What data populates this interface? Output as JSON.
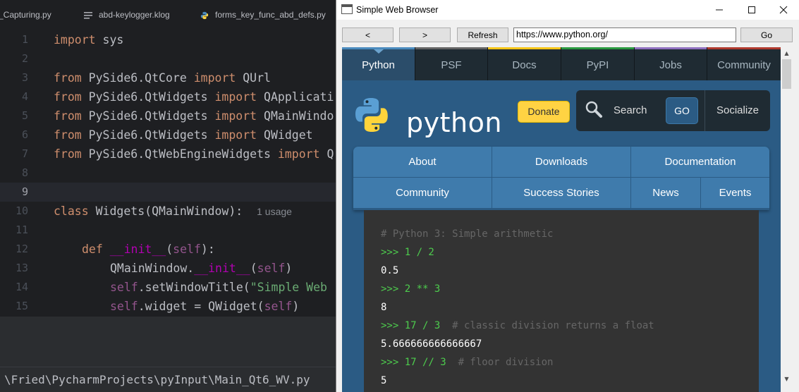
{
  "ide": {
    "tabs": [
      {
        "label": "_Capturing.py"
      },
      {
        "label": "abd-keylogger.klog"
      },
      {
        "label": "forms_key_func_abd_defs.py"
      }
    ],
    "line_numbers": [
      "1",
      "2",
      "3",
      "4",
      "5",
      "6",
      "7",
      "8",
      "9",
      "10",
      "11",
      "12",
      "13",
      "14",
      "15"
    ],
    "code": {
      "l1": {
        "kw": "import",
        "rest": " sys"
      },
      "l3": {
        "kw1": "from",
        "mod": " PySide6.QtCore ",
        "kw2": "import",
        "rest": " QUrl"
      },
      "l4": {
        "kw1": "from",
        "mod": " PySide6.QtWidgets ",
        "kw2": "import",
        "rest": " QApplicati"
      },
      "l5": {
        "kw1": "from",
        "mod": " PySide6.QtWidgets ",
        "kw2": "import",
        "rest": " QMainWindo"
      },
      "l6": {
        "kw1": "from",
        "mod": " PySide6.QtWidgets ",
        "kw2": "import",
        "rest": " QWidget"
      },
      "l7": {
        "kw1": "from",
        "mod": " PySide6.QtWebEngineWidgets ",
        "kw2": "import",
        "rest": " Q"
      },
      "l10": {
        "kw": "class",
        "name": " Widgets",
        "rest": "(QMainWindow):",
        "hint": "1 usage"
      },
      "l12": {
        "kw": "def",
        "name": "__init__",
        "open": "(",
        "self": "self",
        "close": "):"
      },
      "l13": {
        "pre": "QMainWindow.",
        "dunder": "__init__",
        "open": "(",
        "self": "self",
        "close": ")"
      },
      "l14": {
        "self": "self",
        "call": ".setWindowTitle(",
        "str": "\"Simple Web"
      },
      "l15": {
        "self": "self",
        "mid": ".widget = QWidget(",
        "self2": "self",
        "close": ")"
      }
    },
    "status_path": "\\Fried\\PycharmProjects\\pyInput\\Main_Qt6_WV.py"
  },
  "browser": {
    "window_title": "Simple Web Browser",
    "back_label": "<",
    "forward_label": ">",
    "refresh_label": "Refresh",
    "url_value": "https://www.python.org/",
    "go_label": "Go",
    "page": {
      "top_nav": [
        {
          "label": "Python",
          "active": true,
          "color": "#4b8bbe"
        },
        {
          "label": "PSF",
          "color": "#646464"
        },
        {
          "label": "Docs",
          "color": "#f5c518"
        },
        {
          "label": "PyPI",
          "color": "#2b9a40"
        },
        {
          "label": "Jobs",
          "color": "#9070c0"
        },
        {
          "label": "Community",
          "color": "#b03a2e"
        }
      ],
      "logo_text": "python",
      "logo_tm": "™",
      "donate_label": "Donate",
      "search_label": "Search",
      "search_go_label": "GO",
      "socialize_label": "Socialize",
      "main_nav_row1": [
        "About",
        "Downloads",
        "Documentation"
      ],
      "main_nav_row2": [
        "Community",
        "Success Stories",
        "News",
        "Events"
      ],
      "shell": [
        {
          "type": "comment",
          "text": "# Python 3: Simple arithmetic"
        },
        {
          "type": "prompt",
          "text": ">>> 1 / 2"
        },
        {
          "type": "output",
          "text": "0.5"
        },
        {
          "type": "prompt",
          "text": ">>> 2 ** 3"
        },
        {
          "type": "output",
          "text": "8"
        },
        {
          "type": "prompt",
          "text": ">>> 17 / 3",
          "comment": "  # classic division returns a float"
        },
        {
          "type": "output",
          "text": "5.666666666666667"
        },
        {
          "type": "prompt",
          "text": ">>> 17 // 3",
          "comment": "  # floor division"
        },
        {
          "type": "output",
          "text": "5"
        }
      ]
    }
  },
  "colors": {
    "python_blue": "#2b5b84",
    "donate_yellow": "#ffd343",
    "prompt_green": "#4dcc4d"
  }
}
